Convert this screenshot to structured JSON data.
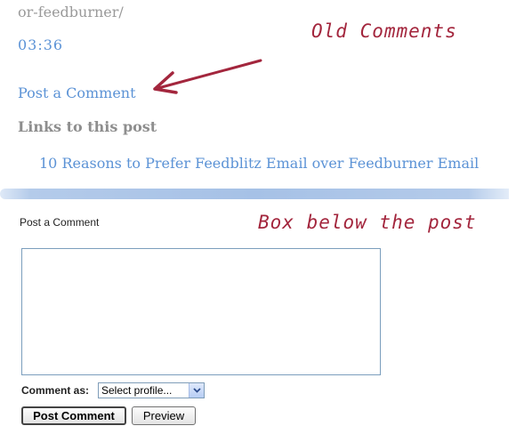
{
  "old_section": {
    "url_fragment": "or-feedburner/",
    "timestamp": "03:36",
    "post_comment_link": "Post a Comment",
    "links_heading": "Links to this post",
    "backlink": "10 Reasons to Prefer Feedblitz Email over Feedburner Email"
  },
  "annotations": {
    "old_comments": "Old Comments",
    "box_below": "Box below the post"
  },
  "comment_form": {
    "title": "Post a Comment",
    "textarea_value": "",
    "comment_as_label": "Comment as:",
    "profile_select": "Select profile...",
    "post_button": "Post Comment",
    "preview_button": "Preview"
  },
  "colors": {
    "link": "#5c93d6",
    "annotation": "#a3263d",
    "divider": "#a6c1e6"
  },
  "icons": {
    "annotation_arrow": "arrow-left-icon",
    "select_dropdown": "chevron-down-icon"
  }
}
